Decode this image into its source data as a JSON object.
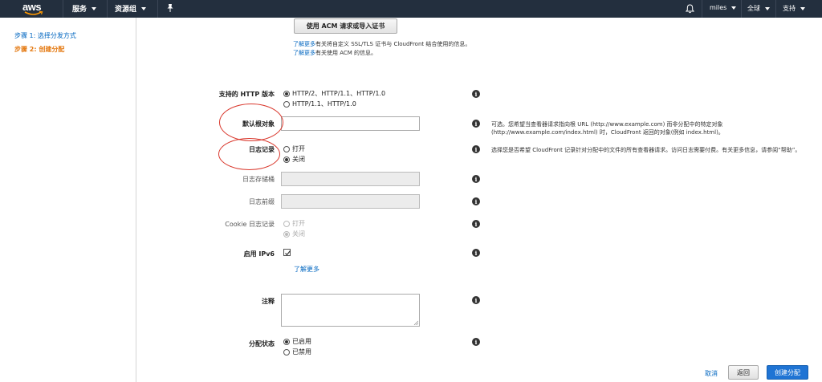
{
  "topnav": {
    "logo": "aws",
    "services": "服务",
    "resource_groups": "资源组",
    "user": "miles",
    "region": "全球",
    "support": "支持"
  },
  "sidebar": {
    "steps": [
      {
        "label": "步骤 1: 选择分发方式",
        "active": false
      },
      {
        "label": "步骤 2: 创建分配",
        "active": true
      }
    ]
  },
  "acm": {
    "button": "使用 ACM 请求或导入证书",
    "help1_link": "了解更多",
    "help1_text": "有关将自定义 SSL/TLS 证书与 CloudFront 结合使用的信息。",
    "help2_link": "了解更多",
    "help2_text": "有关使用 ACM 的信息。"
  },
  "form": {
    "http_label": "支持的 HTTP 版本",
    "http_opt1": "HTTP/2、HTTP/1.1、HTTP/1.0",
    "http_opt2": "HTTP/1.1、HTTP/1.0",
    "root_label": "默认根对象",
    "root_value": "",
    "root_desc": "可选。您希望当查看器请求指向根 URL (http://www.example.com) 而非分配中的特定对象 (http://www.example.com/index.html) 时，CloudFront 返回的对象(例如 index.html)。",
    "log_label": "日志记录",
    "log_on": "打开",
    "log_off": "关闭",
    "log_desc": "选择您是否希望 CloudFront 记录针对分配中的文件的所有查看器请求。访问日志需要付费。有关更多信息，请参阅“帮助”。",
    "bucket_label": "日志存储桶",
    "prefix_label": "日志前缀",
    "cookie_label": "Cookie 日志记录",
    "cookie_on": "打开",
    "cookie_off": "关闭",
    "ipv6_label": "启用 IPv6",
    "ipv6_link": "了解更多",
    "comment_label": "注释",
    "state_label": "分配状态",
    "state_enabled": "已启用",
    "state_disabled": "已禁用"
  },
  "footer": {
    "cancel": "取消",
    "back": "返回",
    "create": "创建分配"
  },
  "colors": {
    "nav_bg": "#232f3e",
    "link": "#0066c0",
    "active_step": "#e47911",
    "primary_button": "#1f74d4",
    "annotation": "#d9362b"
  }
}
